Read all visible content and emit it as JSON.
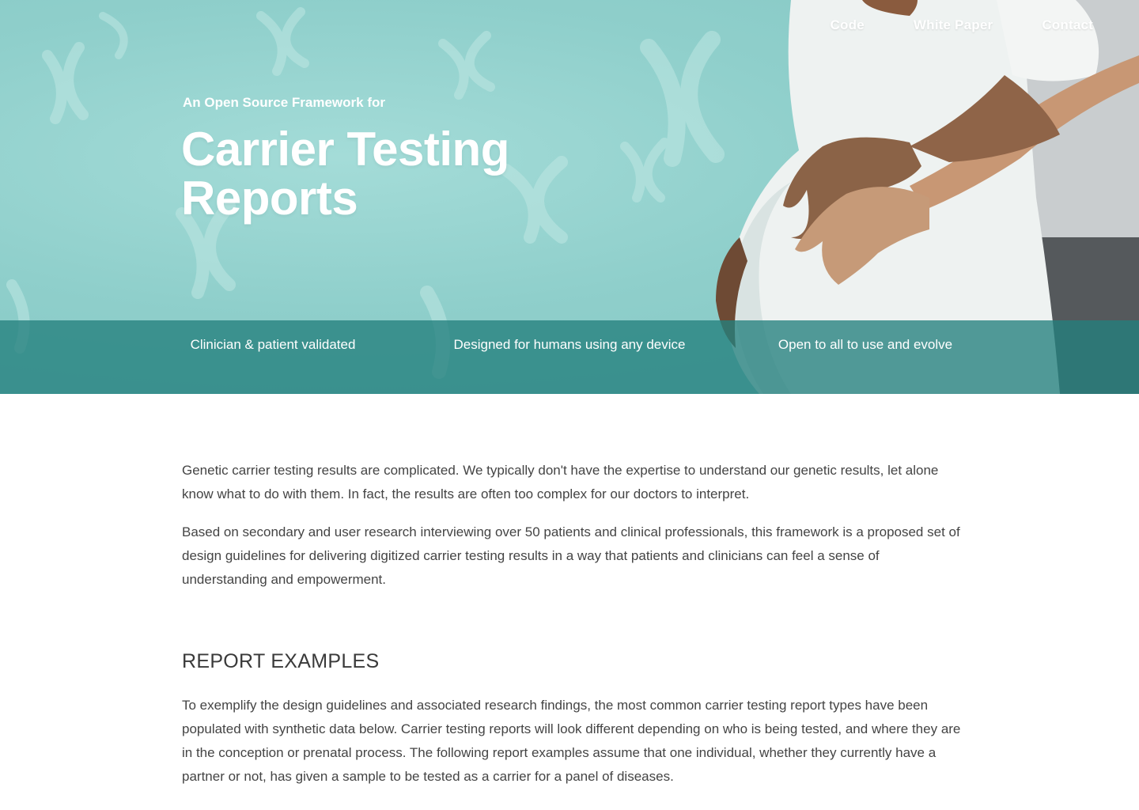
{
  "nav": {
    "items": [
      "Code",
      "White Paper",
      "Contact"
    ]
  },
  "hero": {
    "eyebrow": "An Open Source Framework for",
    "title": "Carrier Testing Reports"
  },
  "features": [
    {
      "label": "Clinician & patient validated"
    },
    {
      "label": "Designed for humans using any device"
    },
    {
      "label": "Open to all to use and evolve"
    }
  ],
  "intro": {
    "p1": "Genetic carrier testing results are complicated. We typically don't have the expertise to understand our genetic results, let alone know what to do with them. In fact, the results are often too complex for our doctors to interpret.",
    "p2": "Based on secondary and user research interviewing over 50 patients and clinical professionals, this framework is a proposed set of design guidelines for delivering digitized carrier testing results in a way that patients and clinicians can feel a sense of understanding and empowerment."
  },
  "examples": {
    "heading": "REPORT EXAMPLES",
    "p1": "To exemplify the design guidelines and associated research findings, the most common carrier testing report types have been populated with synthetic data below. Carrier testing reports will look different depending on who is being tested, and where they are in the conception or prenatal process. The following report examples assume that one individual, whether they currently have a partner or not, has given a sample to be tested as a carrier for a panel of diseases."
  },
  "colors": {
    "hero_bg": "#8fcfcb",
    "band": "#24807e",
    "text": "#444444"
  }
}
